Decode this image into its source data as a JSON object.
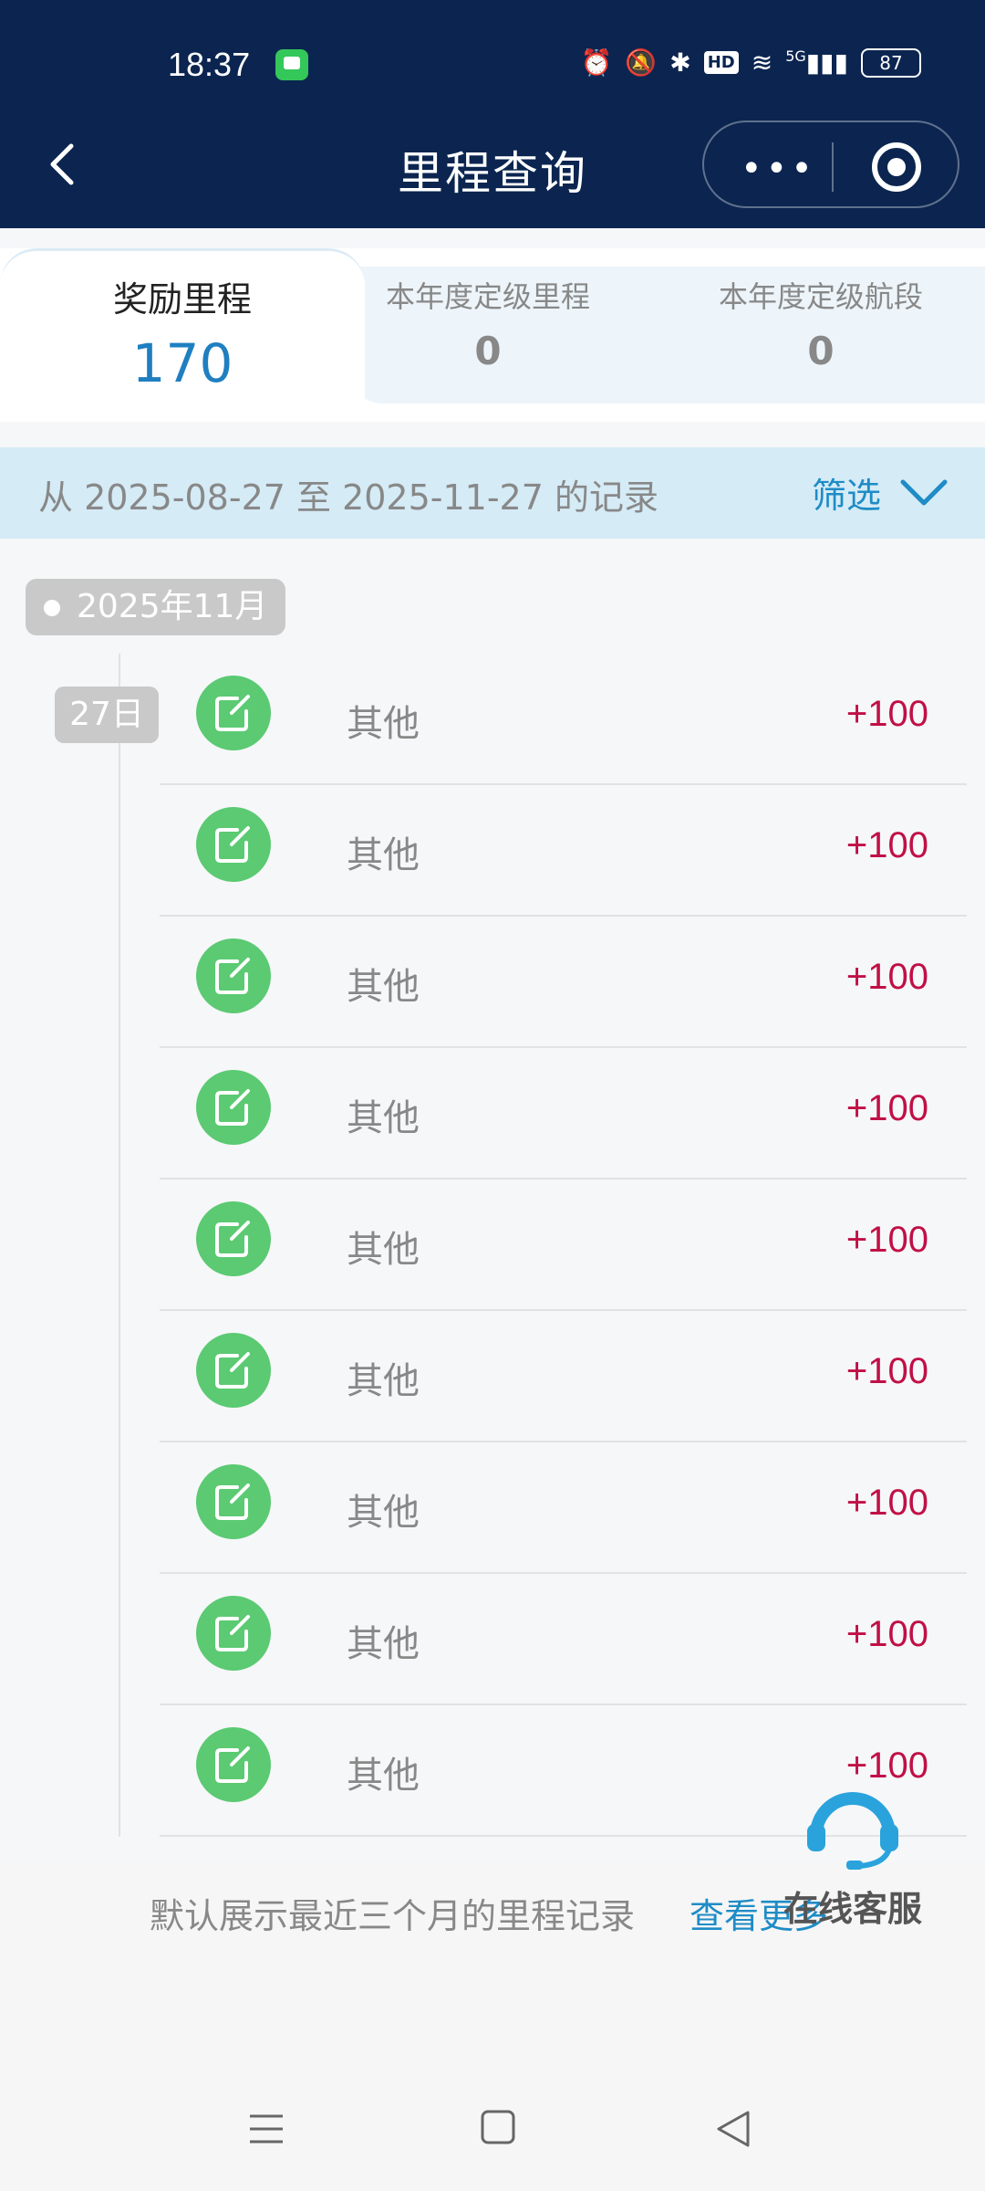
{
  "status_bar": {
    "time": "18:37",
    "battery": "87",
    "network": "5G",
    "hd": "HD"
  },
  "nav": {
    "title": "里程查询"
  },
  "tabs": [
    {
      "label": "奖励里程",
      "value": "170"
    },
    {
      "label": "本年度定级里程",
      "value": "0"
    },
    {
      "label": "本年度定级航段",
      "value": "0"
    }
  ],
  "filter": {
    "range_text": "从 2025-08-27 至 2025-11-27 的记录",
    "button_label": "筛选"
  },
  "timeline": {
    "month": "2025年11月",
    "day": "27日",
    "records": [
      {
        "name": "其他",
        "amount": "+100"
      },
      {
        "name": "其他",
        "amount": "+100"
      },
      {
        "name": "其他",
        "amount": "+100"
      },
      {
        "name": "其他",
        "amount": "+100"
      },
      {
        "name": "其他",
        "amount": "+100"
      },
      {
        "name": "其他",
        "amount": "+100"
      },
      {
        "name": "其他",
        "amount": "+100"
      },
      {
        "name": "其他",
        "amount": "+100"
      },
      {
        "name": "其他",
        "amount": "+100"
      }
    ]
  },
  "footer": {
    "note": "默认展示最近三个月的里程记录",
    "link": "查看更多"
  },
  "customer_service": {
    "label": "在线客服"
  },
  "colors": {
    "header_bg": "#0b2550",
    "accent_blue": "#1f8cc6",
    "amount_red": "#c01046",
    "icon_green": "#5bca72"
  }
}
